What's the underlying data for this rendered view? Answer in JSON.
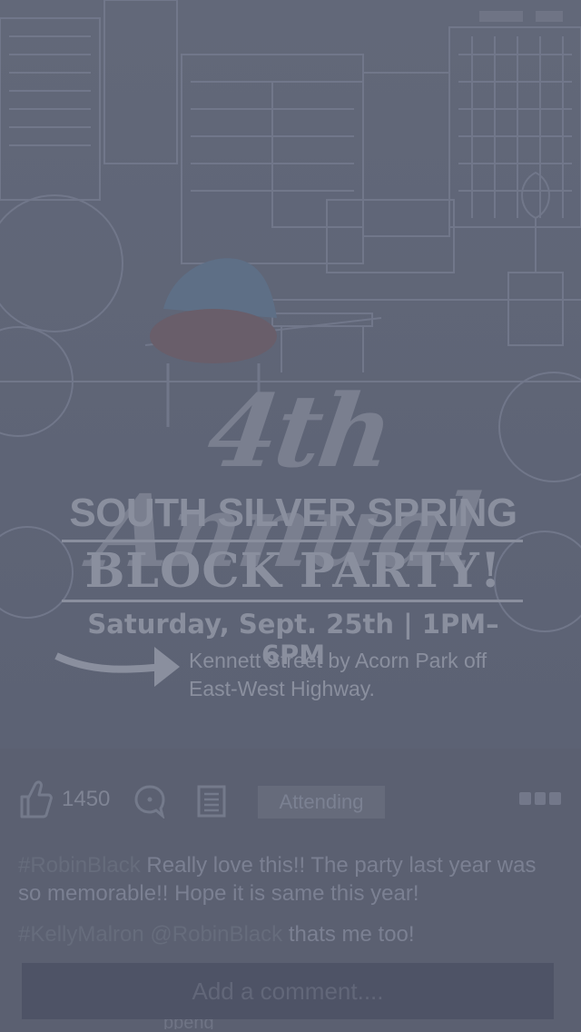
{
  "poster": {
    "title_script": "4th Annual",
    "title_main": "SOUTH SILVER SPRING",
    "title_event": "BLOCK PARTY!",
    "date_line": "Saturday, Sept. 25th | 1PM–6PM",
    "location": "Kennett Street by Acorn Park off East-West Highway.",
    "sign_text": "SILVER SPRING"
  },
  "actions": {
    "like_count": "1450",
    "attending_label": "Attending"
  },
  "comments": [
    {
      "mention": "#RobinBlack",
      "text": " Really love this!! The party last year was so memorable!! Hope it is same this year!"
    },
    {
      "mention": "#KellyMalron @RobinBlack",
      "text": " thats me too!"
    }
  ],
  "composer": {
    "placeholder": "Add a comment....",
    "peek_text": "ppeng"
  },
  "icons": [
    "like-icon",
    "comment-icon",
    "list-icon",
    "more-icon"
  ]
}
